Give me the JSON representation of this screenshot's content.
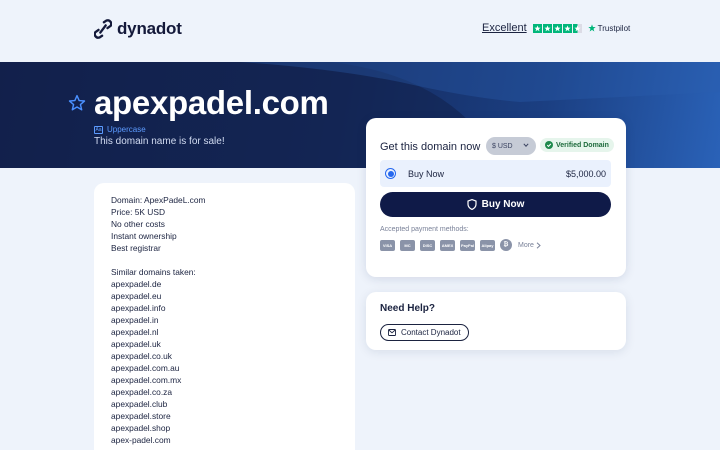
{
  "header": {
    "brand": "dynadot",
    "rating_word": "Excellent",
    "trust_brand": "Trustpilot",
    "rating_stars": 4.5,
    "accent_color": "#00b67a"
  },
  "hero": {
    "domain": "apexpadel.com",
    "uppercase_link": "Uppercase",
    "subtitle": "This domain name is for sale!",
    "colors": {
      "dark": "#13214d",
      "light": "#2a62b8"
    }
  },
  "description": {
    "lines": [
      "Domain: ApexPadeL.com",
      "Price:  5K USD",
      "No other costs",
      "Instant ownership",
      "Best registrar",
      "",
      "Similar domains taken:",
      "apexpadel.de",
      "apexpadel.eu",
      "apexpadel.info",
      "apexpadel.in",
      "apexpadel.nl",
      "apexpadel.uk",
      "apexpadel.co.uk",
      "apexpadel.com.au",
      "apexpadel.com.mx",
      "apexpadel.co.za",
      "apexpadel.club",
      "apexpadel.store",
      "apexpadel.shop",
      "apex-padel.com"
    ]
  },
  "buy": {
    "heading": "Get this domain now",
    "currency": "$ USD",
    "verified": "Verified Domain",
    "option_label": "Buy Now",
    "option_price": "$5,000.00",
    "button_label": "Buy Now",
    "payment_label": "Accepted payment methods:",
    "payment_methods": [
      "VISA",
      "MC",
      "DISC",
      "AMEX",
      "PayPal",
      "Alipay",
      "₿"
    ],
    "more_label": "More",
    "button_color": "#0f1a48",
    "radio_color": "#2568ef"
  },
  "help": {
    "title": "Need Help?",
    "contact_label": "Contact Dynadot"
  }
}
